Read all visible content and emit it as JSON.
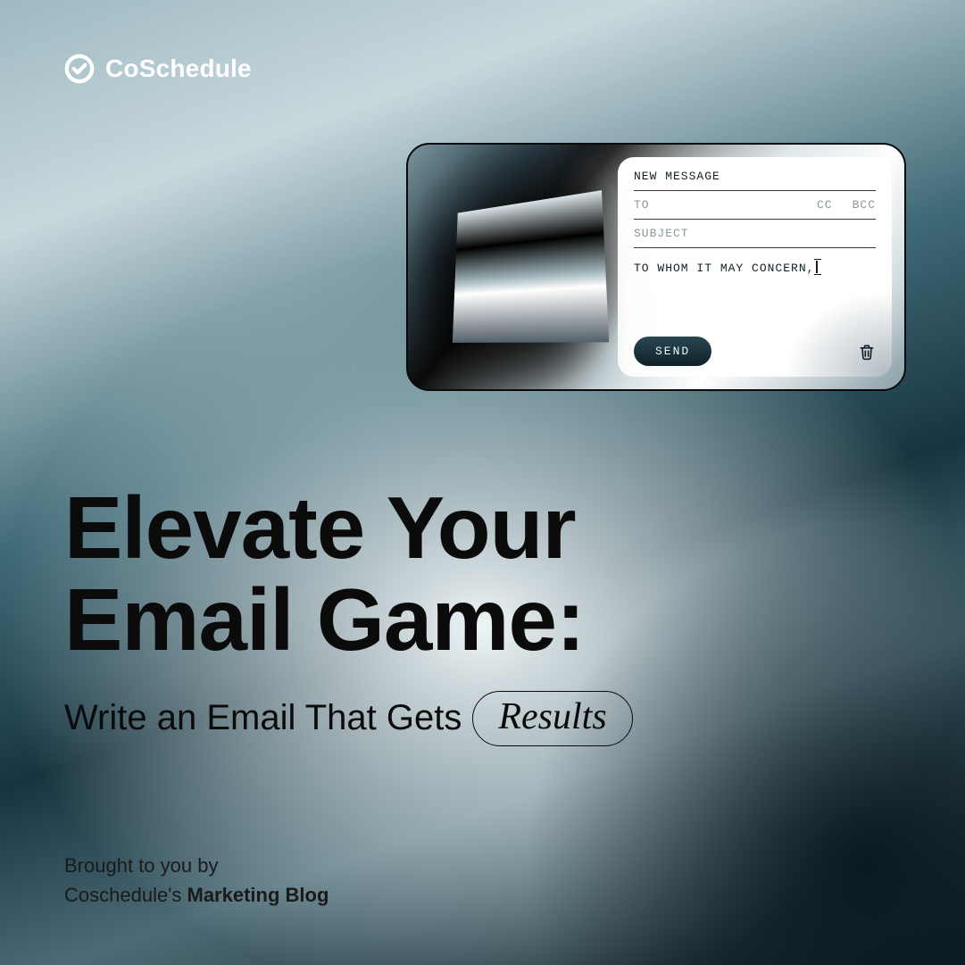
{
  "brand": {
    "name": "CoSchedule"
  },
  "compose": {
    "title": "NEW MESSAGE",
    "to_label": "TO",
    "cc_label": "CC",
    "bcc_label": "BCC",
    "subject_label": "SUBJECT",
    "body_text": "TO WHOM IT MAY CONCERN,",
    "send_label": "SEND"
  },
  "hero": {
    "title_line1": "Elevate Your",
    "title_line2": "Email Game:",
    "subtitle_pre": "Write an Email That Gets",
    "subtitle_pill": "Results"
  },
  "footer": {
    "line1": "Brought to you by",
    "line2_pre": "Coschedule's ",
    "line2_strong": "Marketing Blog"
  }
}
